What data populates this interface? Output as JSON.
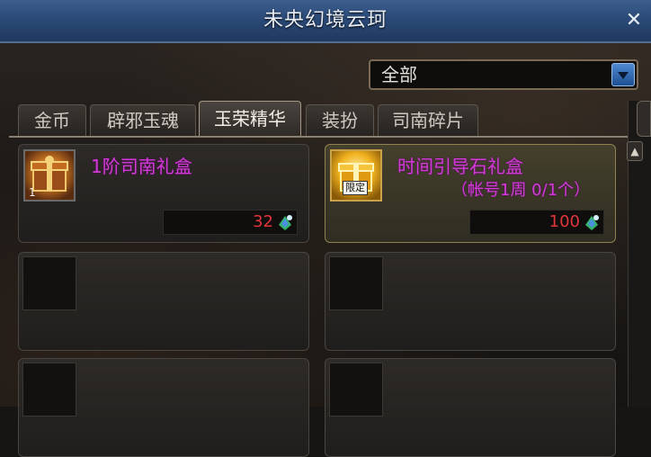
{
  "window": {
    "title": "未央幻境云珂"
  },
  "filter": {
    "selected": "全部"
  },
  "tabs": [
    {
      "label": "金币"
    },
    {
      "label": "辟邪玉魂"
    },
    {
      "label": "玉荣精华"
    },
    {
      "label": "装扮"
    },
    {
      "label": "司南碎片"
    }
  ],
  "active_tab": "玉荣精华",
  "items": [
    {
      "name": "1阶司南礼盒",
      "count": "1",
      "price": "32",
      "limit": ""
    },
    {
      "name": "时间引导石礼盒",
      "badge": "限定",
      "limit": "（帐号1周 0/1个）",
      "price": "100"
    }
  ],
  "colors": {
    "title_bar": "#2b4a78",
    "item_name": "#d23ad8",
    "price": "#e0353a",
    "highlight_card": "#44402c"
  },
  "icons": {
    "close": "close-icon",
    "dropdown": "chevron-down-icon",
    "currency": "yurong-essence-icon",
    "scroll": "scroll-up-icon"
  }
}
